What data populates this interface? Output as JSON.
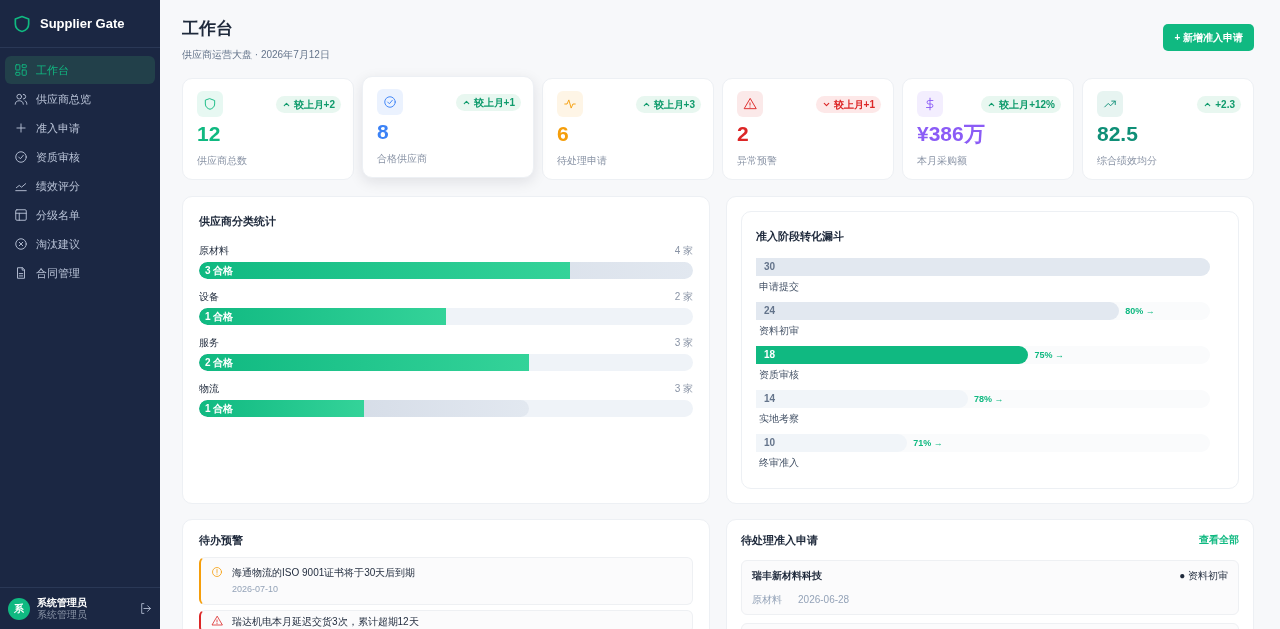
{
  "sidebar": {
    "brand": "Supplier Gate",
    "items": [
      {
        "label": "工作台",
        "selected": true
      },
      {
        "label": "供应商总览",
        "selected": false
      },
      {
        "label": "准入申请",
        "selected": false
      },
      {
        "label": "资质审核",
        "selected": false
      },
      {
        "label": "绩效评分",
        "selected": false
      },
      {
        "label": "分级名单",
        "selected": false
      },
      {
        "label": "淘汰建议",
        "selected": false
      },
      {
        "label": "合同管理",
        "selected": false
      }
    ],
    "user": {
      "avatar": "系",
      "name": "系统管理员",
      "role": "系统管理员"
    }
  },
  "header": {
    "title": "工作台",
    "subtitle": "供应商运营大盘 · 2026年7月12日",
    "button": "+ 新增准入申请"
  },
  "stats": [
    {
      "color": "#10b981",
      "delta": "较上月+2",
      "kind": "up",
      "value": "12",
      "label": "供应商总数",
      "raised": false
    },
    {
      "color": "#3b82f6",
      "delta": "较上月+1",
      "kind": "up",
      "value": "8",
      "label": "合格供应商",
      "raised": true
    },
    {
      "color": "#f59e0b",
      "delta": "较上月+3",
      "kind": "up",
      "value": "6",
      "label": "待处理申请",
      "raised": false
    },
    {
      "color": "#dc2626",
      "delta": "较上月+1",
      "kind": "down",
      "value": "2",
      "label": "异常预警",
      "raised": false
    },
    {
      "color": "#8b5cf6",
      "delta": "较上月+12%",
      "kind": "up",
      "value": "¥386万",
      "label": "本月采购额",
      "raised": false
    },
    {
      "color": "#0f8f77",
      "delta": "+2.3",
      "kind": "up",
      "value": "82.5",
      "label": "综合绩效均分",
      "raised": false
    }
  ],
  "categories": {
    "title": "供应商分类统计",
    "rows": [
      {
        "name": "原材料",
        "count": "4 家",
        "qualified": "3 合格",
        "qualified_bar": {
          "level": 0.75
        },
        "total_bar": {
          "level": 1.0
        }
      },
      {
        "name": "设备",
        "count": "2 家",
        "qualified": "1 合格",
        "qualified_bar": {
          "level": 0.5
        },
        "total_bar": {
          "level": 0.5
        }
      },
      {
        "name": "服务",
        "count": "3 家",
        "qualified": "2 合格",
        "qualified_bar": {
          "level": 0.667
        },
        "total_bar": {
          "level": 0.667
        }
      },
      {
        "name": "物流",
        "count": "3 家",
        "qualified": "1 合格",
        "qualified_bar": {
          "level": 0.333
        },
        "total_bar": {
          "level": 0.667
        }
      }
    ]
  },
  "funnel": {
    "title": "准入阶段转化漏斗",
    "stages": [
      {
        "value": "30",
        "label": "申请提交",
        "level": 1.0,
        "kind": "done"
      },
      {
        "value": "24",
        "label": "资料初审",
        "level": 0.8,
        "kind": "done",
        "rate": "80% →"
      },
      {
        "value": "18",
        "label": "资质审核",
        "level": 0.6,
        "kind": "current",
        "rate": "75% →"
      },
      {
        "value": "14",
        "label": "实地考察",
        "level": 0.467,
        "kind": "todo",
        "rate": "78% →"
      },
      {
        "value": "10",
        "label": "终审准入",
        "level": 0.333,
        "kind": "todo",
        "rate": "71% →"
      }
    ]
  },
  "alerts": {
    "title": "待办预警",
    "items": [
      {
        "kind": "warning",
        "text": "海通物流的ISO 9001证书将于30天后到期",
        "date": "2026-07-10"
      },
      {
        "kind": "danger",
        "text": "瑞达机电本月延迟交货3次，累计超期12天"
      }
    ]
  },
  "applications": {
    "title": "待处理准入申请",
    "link": "查看全部",
    "items": [
      {
        "name": "瑞丰新材料科技",
        "stage": "● 资料初审",
        "category": "原材料",
        "date": "2026-06-28"
      }
    ]
  }
}
